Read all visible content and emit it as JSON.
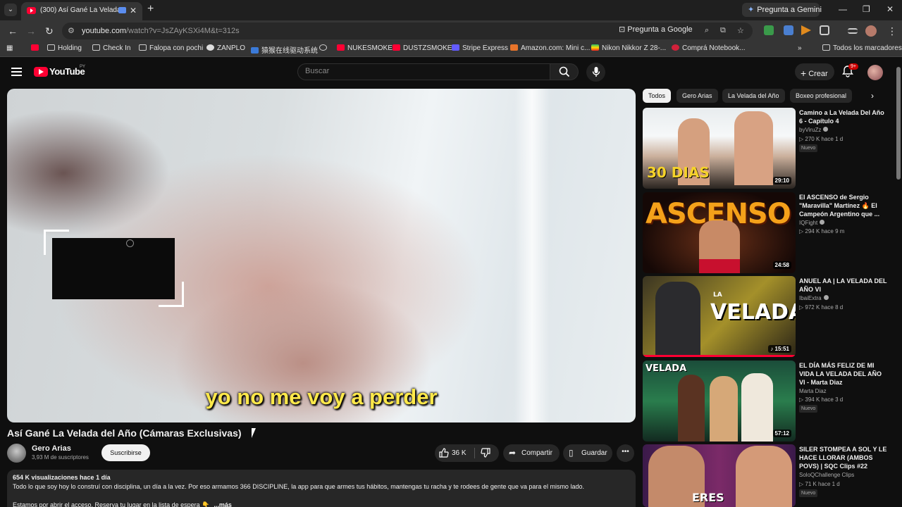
{
  "browser": {
    "tab_title": "(300) Así Gané La Velada de",
    "gemini_label": "Pregunta a Gemini",
    "url_main": "youtube.com",
    "url_rest": "/watch?v=JsZAyKSXi4M&t=312s",
    "ask_google": "Pregunta a Google",
    "bookmarks": [
      "Holding",
      "Check In",
      "Falopa con pochi",
      "ZANPLO",
      "猿猴在线驱动系统",
      "NUKESMOKE",
      "DUSTZSMOKE",
      "Stripe Express",
      "Amazon.com: Mini c...",
      "Nikon Nikkor Z 28-...",
      "Comprá Notebook..."
    ],
    "all_bookmarks": "Todos los marcadores"
  },
  "youtube": {
    "logo_text": "YouTube",
    "country": "PY",
    "search_placeholder": "Buscar",
    "create_label": "Crear",
    "notif_badge": "9+"
  },
  "video": {
    "subtitle": "yo no me voy a perder",
    "title": "Así Gané La Velada del Año (Cámaras Exclusivas)",
    "channel": "Gero Arias",
    "subs": "3,93 M de suscriptores",
    "subscribe": "Suscribirse",
    "likes": "36 K",
    "share": "Compartir",
    "save": "Guardar",
    "desc_meta": "654 K visualizaciones  hace 1 día",
    "desc_line1": "Todo lo que soy hoy lo construí con disciplina, un día a la vez. Por eso armamos 366 DISCIPLINE, la app para que armes tus hábitos, mantengas tu racha y te rodees de gente que va para el mismo lado.",
    "desc_line2": "Estamos por abrir el acceso. Reserva tu lugar en la lista de espera 👇",
    "desc_more": "...más"
  },
  "chips": [
    "Todos",
    "Gero Arias",
    "La Velada del Año",
    "Boxeo profesional"
  ],
  "recommendations": [
    {
      "title": "Camino a La Velada Del Año 6 - Capítulo 4",
      "channel": "byViruZz",
      "meta": "▷ 270 K  hace 1 d",
      "badge": "Nuevo",
      "duration": "29:10",
      "thumb_text": "30 DIAS"
    },
    {
      "title": "El ASCENSO de Sergio \"Maravilla\" Martínez 🔥 El Campeón Argentino que ...",
      "channel": "IQFight",
      "meta": "▷ 294 K  hace 9 m",
      "badge": "",
      "duration": "24:58",
      "thumb_text": "ASCENSO"
    },
    {
      "title": "ANUEL AA | LA VELADA DEL AÑO VI",
      "channel": "IbaiExtra",
      "meta": "▷ 972 K  hace 8 d",
      "badge": "",
      "duration": "15:51",
      "thumb_text": "VELADA"
    },
    {
      "title": "EL DÍA MÁS FELIZ DE MI VIDA LA VELADA DEL AÑO VI - Marta Diaz",
      "channel": "Marta Diaz",
      "meta": "▷ 394 K  hace 3 d",
      "badge": "Nuevo",
      "duration": "57:12",
      "thumb_text": "VELADA"
    },
    {
      "title": "SILER STOMPEA A SOL Y LE HACE LLORAR (AMBOS POVS) | SQC Clips #22",
      "channel": "SoloQChallenge Clips",
      "meta": "▷ 71 K  hace 1 d",
      "badge": "Nuevo",
      "duration": "",
      "thumb_text": "ERES"
    }
  ]
}
